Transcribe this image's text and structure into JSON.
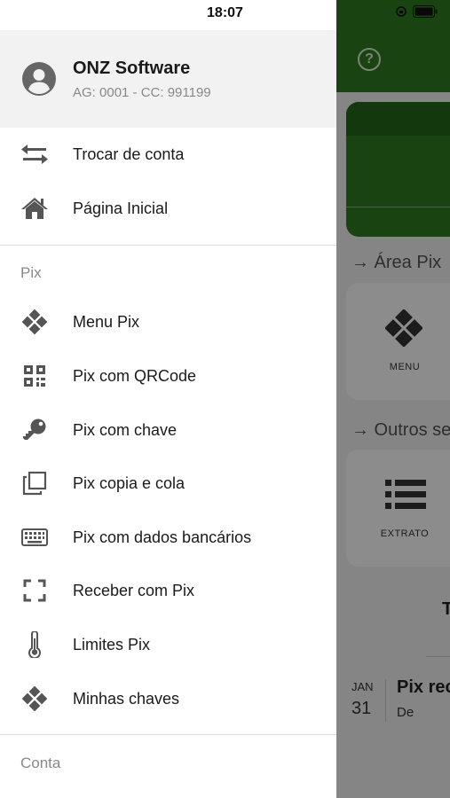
{
  "status_bar": {
    "time": "18:07"
  },
  "profile": {
    "name": "ONZ Software",
    "account": "AG: 0001 - CC: 991199"
  },
  "top_items": [
    {
      "label": "Trocar de conta",
      "icon": "swap-icon"
    },
    {
      "label": "Página Inicial",
      "icon": "home-icon"
    }
  ],
  "pix_section": {
    "title": "Pix",
    "items": [
      {
        "label": "Menu Pix",
        "icon": "pix-icon"
      },
      {
        "label": "Pix com QRCode",
        "icon": "qrcode-icon"
      },
      {
        "label": "Pix com chave",
        "icon": "key-icon"
      },
      {
        "label": "Pix copia e cola",
        "icon": "copy-icon"
      },
      {
        "label": "Pix com dados bancários",
        "icon": "keyboard-icon"
      },
      {
        "label": "Receber com Pix",
        "icon": "scan-icon"
      },
      {
        "label": "Limites Pix",
        "icon": "thermometer-icon"
      },
      {
        "label": "Minhas chaves",
        "icon": "pix-icon"
      }
    ]
  },
  "conta_section": {
    "title": "Conta"
  },
  "background": {
    "section_area_pix": "→ Área Pix",
    "tile_menu": "MENU",
    "section_outros": "→ Outros se",
    "tile_extrato": "EXTRATO",
    "partial_title": "T",
    "tx_month": "JAN",
    "tx_day": "31",
    "tx_title": "Pix rec",
    "tx_sub": "De"
  },
  "colors": {
    "brand_green": "#2e7d1f",
    "drawer_bg": "#ffffff",
    "profile_bg": "#f2f2f2"
  }
}
